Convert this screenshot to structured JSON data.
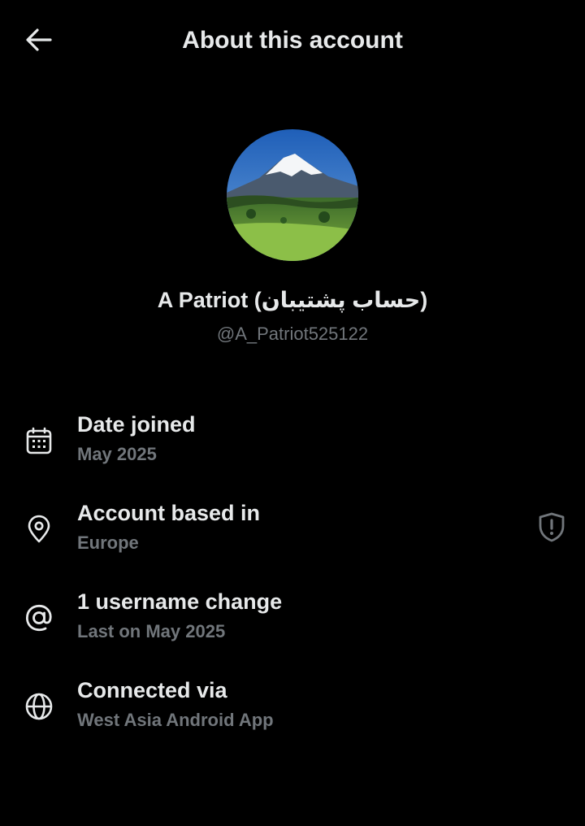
{
  "header": {
    "title": "About this account",
    "back_icon": "arrow-left-icon"
  },
  "profile": {
    "display_name": "A Patriot (حساب پشتیبان)",
    "handle": "@A_Patriot525122",
    "avatar": "mountain-landscape-avatar"
  },
  "details": [
    {
      "icon": "calendar-icon",
      "title": "Date joined",
      "value": "May 2025"
    },
    {
      "icon": "location-pin-icon",
      "title": "Account based in",
      "value": "Europe",
      "extra_icon": "shield-alert-icon"
    },
    {
      "icon": "at-sign-icon",
      "title": "1 username change",
      "value": "Last on May 2025"
    },
    {
      "icon": "globe-icon",
      "title": "Connected via",
      "value": "West Asia Android App"
    }
  ],
  "colors": {
    "background": "#000000",
    "primary_text": "#e7e9ea",
    "secondary_text": "#71767b"
  }
}
